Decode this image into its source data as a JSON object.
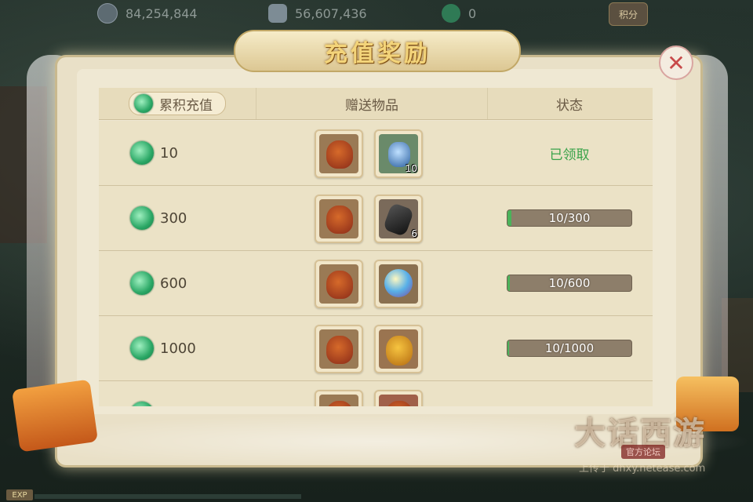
{
  "currencies": [
    {
      "icon": "silver-coin-icon",
      "value": "84,254,844"
    },
    {
      "icon": "silver-ingot-icon",
      "value": "56,607,436"
    },
    {
      "icon": "jade-icon",
      "value": "0"
    }
  ],
  "points_button": "积分",
  "title": "充值奖励",
  "header": {
    "cumulative": "累积充值",
    "gifts": "赠送物品",
    "status": "状态"
  },
  "rows": [
    {
      "amount": "10",
      "items": [
        {
          "icon": "treasure-bag-icon",
          "count": ""
        },
        {
          "icon": "vase-icon",
          "count": "10"
        }
      ],
      "status_type": "claimed",
      "status_text": "已领取"
    },
    {
      "amount": "300",
      "items": [
        {
          "icon": "treasure-bag-icon",
          "count": ""
        },
        {
          "icon": "dark-stone-icon",
          "count": "6"
        }
      ],
      "status_type": "progress",
      "progress_text": "10/300",
      "progress": 0.033
    },
    {
      "amount": "600",
      "items": [
        {
          "icon": "treasure-bag-icon",
          "count": ""
        },
        {
          "icon": "crystal-orb-icon",
          "count": ""
        }
      ],
      "status_type": "progress",
      "progress_text": "10/600",
      "progress": 0.017
    },
    {
      "amount": "1000",
      "items": [
        {
          "icon": "treasure-bag-icon",
          "count": ""
        },
        {
          "icon": "gold-bag-icon",
          "count": ""
        }
      ],
      "status_type": "progress",
      "progress_text": "10/1000",
      "progress": 0.01
    }
  ],
  "watermark": {
    "main": "大话西游",
    "sub": "官方论坛",
    "url": "上传于 dhxy.netease.com"
  },
  "exp_label": "EXP",
  "colors": {
    "claimed": "#3aa34a",
    "progress_fill": "#4bb35a",
    "title_gold": "#f3d47a"
  }
}
